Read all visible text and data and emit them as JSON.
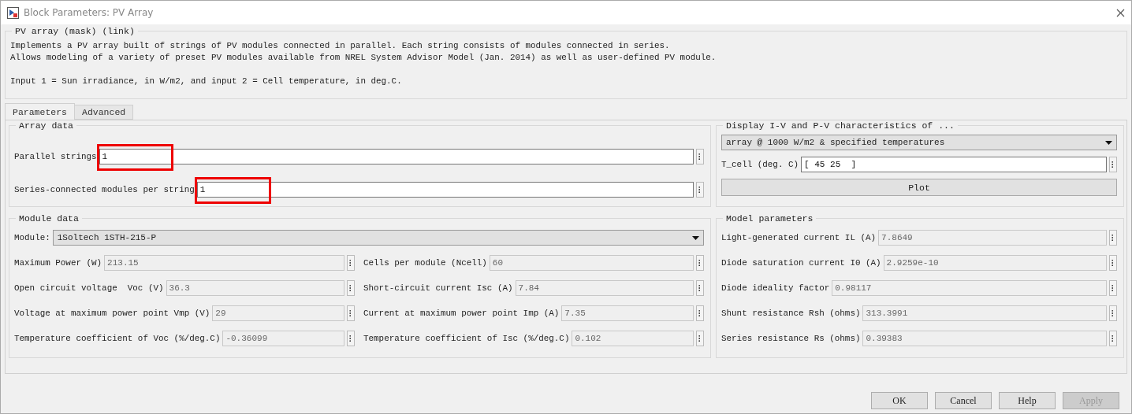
{
  "window": {
    "title": "Block Parameters: PV Array"
  },
  "description": {
    "title": "PV array (mask) (link)",
    "paragraphs": [
      [
        "Implements a PV array built of strings of PV modules connected in parallel. Each string consists of modules connected in series.",
        "Allows modeling of a variety of preset PV modules available from NREL System Advisor Model (Jan. 2014) as well as user-defined PV module."
      ],
      [
        "Input 1 = Sun irradiance, in W/m2, and input 2 = Cell temperature, in deg.C."
      ]
    ]
  },
  "tabs": [
    {
      "label": "Parameters",
      "selected": true
    },
    {
      "label": "Advanced",
      "selected": false
    }
  ],
  "array_data": {
    "title": "Array data",
    "fields": [
      {
        "label": "Parallel strings",
        "value": "1",
        "disabled": false,
        "highlighted": true
      },
      {
        "label": "Series-connected modules per string",
        "value": "1",
        "disabled": false,
        "highlighted": true
      }
    ]
  },
  "display": {
    "title": "Display  I-V and P-V characteristics of ...",
    "dropdown": "array @ 1000 W/m2 & specified temperatures",
    "t_cell": {
      "label": "T_cell (deg. C)",
      "value": "[ 45 25  ]",
      "disabled": false
    },
    "plot_button": "Plot"
  },
  "module_data": {
    "title": "Module data",
    "module": {
      "label": "Module:",
      "value": "1Soltech 1STH-215-P"
    },
    "left": [
      {
        "label": "Maximum Power (W)",
        "value": "213.15",
        "disabled": true
      },
      {
        "label": "Open circuit voltage  Voc (V)",
        "value": "36.3",
        "disabled": true
      },
      {
        "label": "Voltage at maximum power point Vmp (V)",
        "value": "29",
        "disabled": true
      },
      {
        "label": "Temperature coefficient of Voc (%/deg.C)",
        "value": "-0.36099",
        "disabled": true
      }
    ],
    "right": [
      {
        "label": "Cells per module (Ncell)",
        "value": "60",
        "disabled": true
      },
      {
        "label": "Short-circuit current Isc (A)",
        "value": "7.84",
        "disabled": true
      },
      {
        "label": "Current at maximum power point Imp (A)",
        "value": "7.35",
        "disabled": true
      },
      {
        "label": "Temperature coefficient of Isc (%/deg.C)",
        "value": "0.102",
        "disabled": true
      }
    ]
  },
  "model_parameters": {
    "title": "Model parameters",
    "fields": [
      {
        "label": "Light-generated current IL (A)",
        "value": "7.8649",
        "disabled": true
      },
      {
        "label": "Diode saturation current I0 (A)",
        "value": "2.9259e-10",
        "disabled": true
      },
      {
        "label": "Diode ideality factor",
        "value": "0.98117",
        "disabled": true
      },
      {
        "label": "Shunt resistance Rsh (ohms)",
        "value": "313.3991",
        "disabled": true
      },
      {
        "label": "Series resistance Rs (ohms)",
        "value": "0.39383",
        "disabled": true
      }
    ]
  },
  "buttons": [
    {
      "label": "OK",
      "disabled": false
    },
    {
      "label": "Cancel",
      "disabled": false
    },
    {
      "label": "Help",
      "disabled": false
    },
    {
      "label": "Apply",
      "disabled": true
    }
  ]
}
